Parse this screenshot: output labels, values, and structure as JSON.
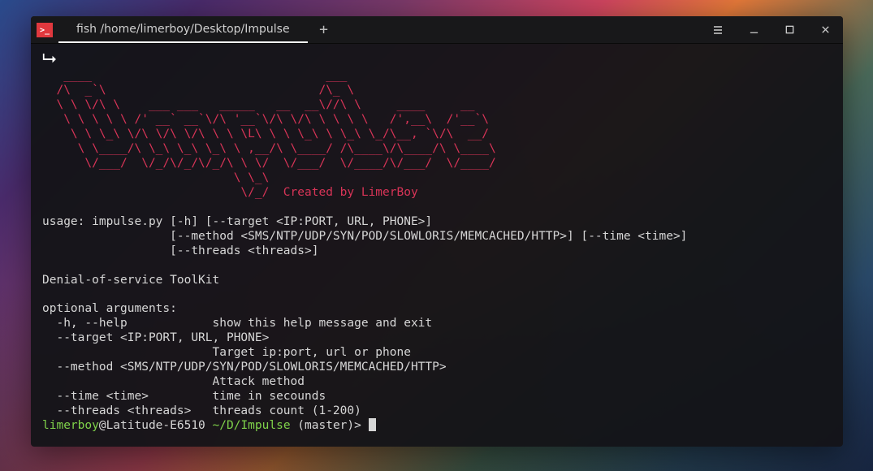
{
  "titlebar": {
    "tab_label": "fish /home/limerboy/Desktop/Impulse"
  },
  "terminal": {
    "pointer": "▻",
    "ascii_art": "   ____                                 ___\n  /\\  _`\\                              /\\_ \\\n  \\ \\ \\/\\ \\    ___ ___   _____   __  __\\//\\ \\     ____     __\n   \\ \\ \\ \\ \\ /' __` __`\\/\\ '__`\\/\\ \\/\\ \\ \\ \\ \\   /',__\\  /'__`\\\n    \\ \\ \\_\\ \\/\\ \\/\\ \\/\\ \\ \\ \\L\\ \\ \\ \\_\\ \\ \\_\\ \\_/\\__, `\\/\\  __/\n     \\ \\____/\\ \\_\\ \\_\\ \\_\\ \\ ,__/\\ \\____/ /\\____\\/\\____/\\ \\____\\\n      \\/___/  \\/_/\\/_/\\/_/\\ \\ \\/  \\/___/  \\/____/\\/___/  \\/____/\n                           \\ \\_\\",
    "credit_line": "                            \\/_/  Created by LimerBoy",
    "usage_text": "usage: impulse.py [-h] [--target <IP:PORT, URL, PHONE>]\n                  [--method <SMS/NTP/UDP/SYN/POD/SLOWLORIS/MEMCACHED/HTTP>] [--time <time>]\n                  [--threads <threads>]\n\nDenial-of-service ToolKit\n\noptional arguments:\n  -h, --help            show this help message and exit\n  --target <IP:PORT, URL, PHONE>\n                        Target ip:port, url or phone\n  --method <SMS/NTP/UDP/SYN/POD/SLOWLORIS/MEMCACHED/HTTP>\n                        Attack method\n  --time <time>         time in secounds\n  --threads <threads>   threads count (1-200)",
    "prompt": {
      "user": "limerboy",
      "at_host": "@Latitude-E6510 ",
      "path": "~/D/Impulse",
      "branch": " (master)> "
    }
  }
}
